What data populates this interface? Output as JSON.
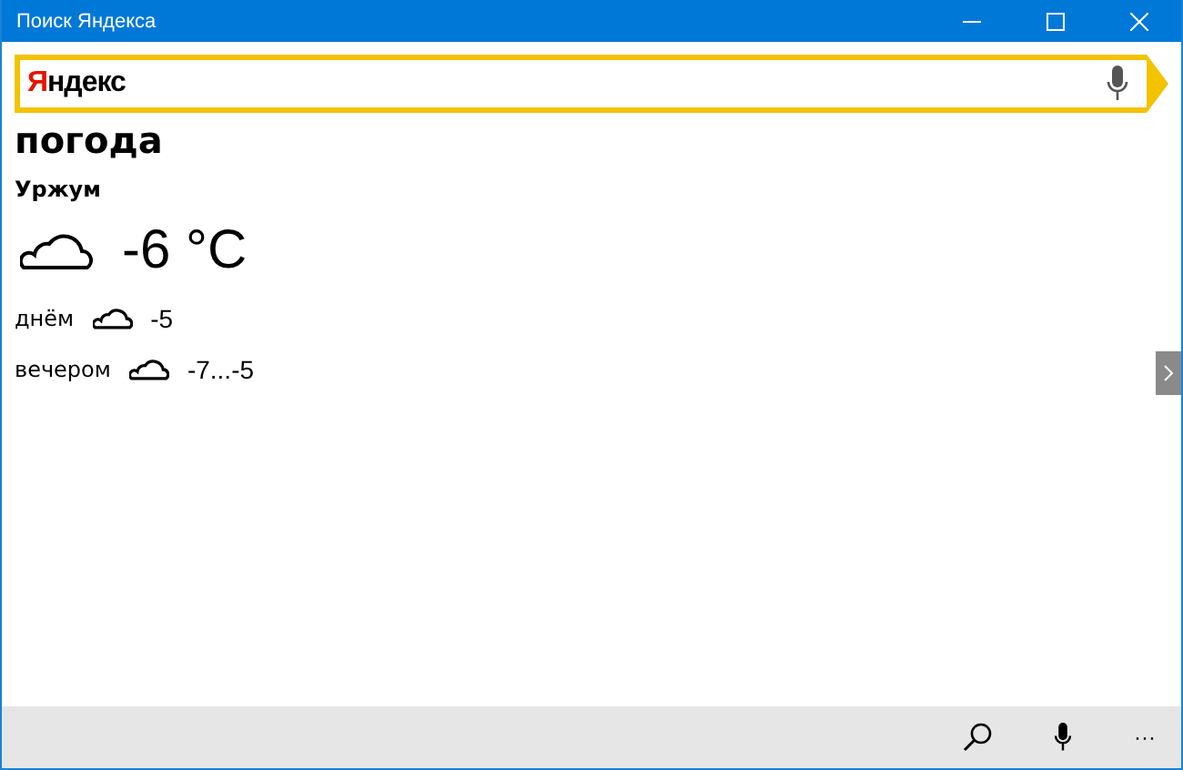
{
  "window": {
    "title": "Поиск Яндекса"
  },
  "search": {
    "logo": "Яндекс"
  },
  "query": "погода",
  "city": "Уржум",
  "current": {
    "temperature": "-6 °C"
  },
  "forecast": [
    {
      "label": "днём",
      "temperature": "-5"
    },
    {
      "label": "вечером",
      "temperature": "-7...-5"
    }
  ],
  "app_bar": {
    "more": "···"
  }
}
